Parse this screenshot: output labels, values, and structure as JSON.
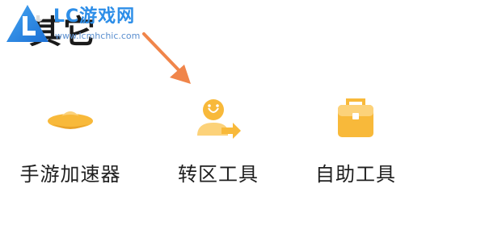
{
  "section": {
    "title": "其它"
  },
  "watermark": {
    "brand": "LC游戏网",
    "url": "www.lcmhchic.com"
  },
  "tools": [
    {
      "label": "手游加速器",
      "icon": "ufo-hat-icon"
    },
    {
      "label": "转区工具",
      "icon": "user-transfer-icon"
    },
    {
      "label": "自助工具",
      "icon": "toolbox-icon"
    }
  ],
  "colors": {
    "icon_accent": "#f8b93a",
    "annotation_arrow": "#f0854a",
    "watermark_blue": "#2d8ee8"
  }
}
